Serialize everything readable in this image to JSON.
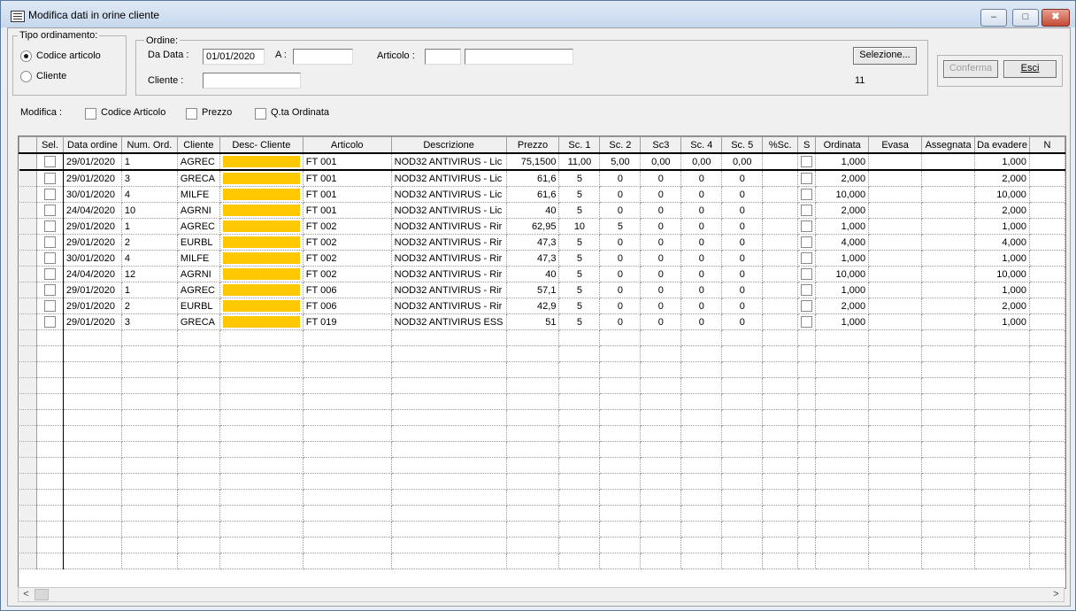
{
  "window": {
    "title": "Modifica dati in orine cliente",
    "controls": [
      "‒",
      "□",
      "✖"
    ]
  },
  "sort": {
    "legend": "Tipo ordinamento:",
    "options": [
      {
        "label": "Codice articolo",
        "selected": true
      },
      {
        "label": "Cliente",
        "selected": false
      }
    ]
  },
  "ordine": {
    "legend": "Ordine:",
    "da_data_label": "Da Data :",
    "da_data_value": "01/01/2020",
    "a_label": "A :",
    "a_value": "",
    "articolo_label": "Articolo :",
    "articolo_value1": "",
    "articolo_value2": "",
    "cliente_label": "Cliente :",
    "cliente_value": "",
    "selezione_label": "Selezione...",
    "count": "11"
  },
  "actions": {
    "conferma_label": "Conferma",
    "esci_label": "Esci"
  },
  "modifica": {
    "label": "Modifica :",
    "options": [
      "Codice Articolo",
      "Prezzo",
      "Q.ta Ordinata"
    ]
  },
  "grid": {
    "headers": [
      "",
      "Sel.",
      "Data ordine",
      "Num. Ord.",
      "Cliente",
      "Desc- Cliente",
      "Articolo",
      "Descrizione",
      "Prezzo",
      "Sc. 1",
      "Sc. 2",
      "Sc3",
      "Sc. 4",
      "Sc. 5",
      "%Sc.",
      "S",
      "Ordinata",
      "Evasa",
      "Assegnata",
      "Da evadere",
      "N"
    ],
    "rows": [
      [
        "29/01/2020",
        "1",
        "AGREC",
        "FT 001",
        "NOD32 ANTIVIRUS - Lic",
        "75,1500",
        "11,00",
        "5,00",
        "0,00",
        "0,00",
        "0,00",
        "1,000",
        "1,000"
      ],
      [
        "29/01/2020",
        "3",
        "GRECA",
        "FT 001",
        "NOD32 ANTIVIRUS - Lic",
        "61,6",
        "5",
        "0",
        "0",
        "0",
        "0",
        "2,000",
        "2,000"
      ],
      [
        "30/01/2020",
        "4",
        "MILFE",
        "FT 001",
        "NOD32 ANTIVIRUS - Lic",
        "61,6",
        "5",
        "0",
        "0",
        "0",
        "0",
        "10,000",
        "10,000"
      ],
      [
        "24/04/2020",
        "10",
        "AGRNI",
        "FT 001",
        "NOD32 ANTIVIRUS - Lic",
        "40",
        "5",
        "0",
        "0",
        "0",
        "0",
        "2,000",
        "2,000"
      ],
      [
        "29/01/2020",
        "1",
        "AGREC",
        "FT 002",
        "NOD32 ANTIVIRUS - Rir",
        "62,95",
        "10",
        "5",
        "0",
        "0",
        "0",
        "1,000",
        "1,000"
      ],
      [
        "29/01/2020",
        "2",
        "EURBL",
        "FT 002",
        "NOD32 ANTIVIRUS - Rir",
        "47,3",
        "5",
        "0",
        "0",
        "0",
        "0",
        "4,000",
        "4,000"
      ],
      [
        "30/01/2020",
        "4",
        "MILFE",
        "FT 002",
        "NOD32 ANTIVIRUS - Rir",
        "47,3",
        "5",
        "0",
        "0",
        "0",
        "0",
        "1,000",
        "1,000"
      ],
      [
        "24/04/2020",
        "12",
        "AGRNI",
        "FT 002",
        "NOD32 ANTIVIRUS - Rir",
        "40",
        "5",
        "0",
        "0",
        "0",
        "0",
        "10,000",
        "10,000"
      ],
      [
        "29/01/2020",
        "1",
        "AGREC",
        "FT 006",
        "NOD32 ANTIVIRUS - Rir",
        "57,1",
        "5",
        "0",
        "0",
        "0",
        "0",
        "1,000",
        "1,000"
      ],
      [
        "29/01/2020",
        "2",
        "EURBL",
        "FT 006",
        "NOD32 ANTIVIRUS - Rir",
        "42,9",
        "5",
        "0",
        "0",
        "0",
        "0",
        "2,000",
        "2,000"
      ],
      [
        "29/01/2020",
        "3",
        "GRECA",
        "FT 019",
        "NOD32 ANTIVIRUS ESS",
        "51",
        "5",
        "0",
        "0",
        "0",
        "0",
        "1,000",
        "1,000"
      ]
    ],
    "empty_rows": 15,
    "highlight_color": "#ffc800"
  },
  "scroll": {
    "left": "<",
    "right": ">"
  }
}
